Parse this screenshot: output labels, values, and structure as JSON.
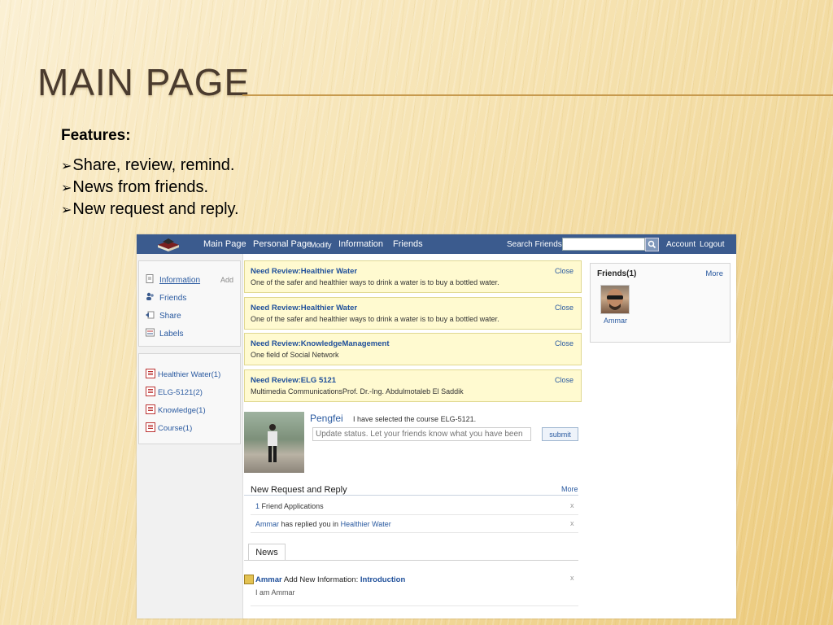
{
  "slide": {
    "title": "Main Page",
    "features_heading": "Features:",
    "bullets": [
      "Share, review, remind.",
      "News from friends.",
      "New request and reply."
    ]
  },
  "topbar": {
    "nav": [
      "Main Page",
      "Personal Page",
      "Modify",
      "Information",
      "Friends"
    ],
    "search_label": "Search Friends",
    "search_value": "",
    "account": "Account",
    "logout": "Logout",
    "color": "#3b5b8e"
  },
  "sidebar": {
    "menu": [
      {
        "label": "Information",
        "icon": "document-icon"
      },
      {
        "label": "Friends",
        "icon": "users-icon"
      },
      {
        "label": "Share",
        "icon": "share-icon"
      },
      {
        "label": "Labels",
        "icon": "labels-icon"
      }
    ],
    "add_label": "Add",
    "tags": [
      "Healthier Water(1)",
      "ELG-5121(2)",
      "Knowledge(1)",
      "Course(1)"
    ]
  },
  "reviews": [
    {
      "title": "Need Review:Healthier Water",
      "desc": "One of the safer and healthier ways to drink a water is to buy a bottled water.",
      "close": "Close"
    },
    {
      "title": "Need Review:Healthier Water",
      "desc": "One of the safer and healthier ways to drink a water is to buy a bottled water.",
      "close": "Close"
    },
    {
      "title": "Need Review:KnowledgeManagement",
      "desc": "One field of Social Network",
      "close": "Close"
    },
    {
      "title": "Need Review:ELG 5121",
      "desc": "Multimedia CommunicationsProf. Dr.-Ing. Abdulmotaleb El Saddik",
      "close": "Close"
    }
  ],
  "status": {
    "user": "Pengfei",
    "text": "I have selected the course ELG-5121.",
    "placeholder": "Update status. Let your friends know what you have been",
    "submit": "submit"
  },
  "requests": {
    "heading": "New Request and Reply",
    "more": "More",
    "row1": {
      "count": "1",
      "text": "Friend Applications",
      "dismiss": "x"
    },
    "row2": {
      "user": "Ammar",
      "text": "has replied you in",
      "topic": "Healthier Water",
      "dismiss": "x"
    }
  },
  "news": {
    "tab": "News",
    "user": "Ammar",
    "action": "Add New Information:",
    "topic": "Introduction",
    "sub": "I am Ammar",
    "dismiss": "x"
  },
  "friends": {
    "title": "Friends(1)",
    "more": "More",
    "name": "Ammar"
  }
}
